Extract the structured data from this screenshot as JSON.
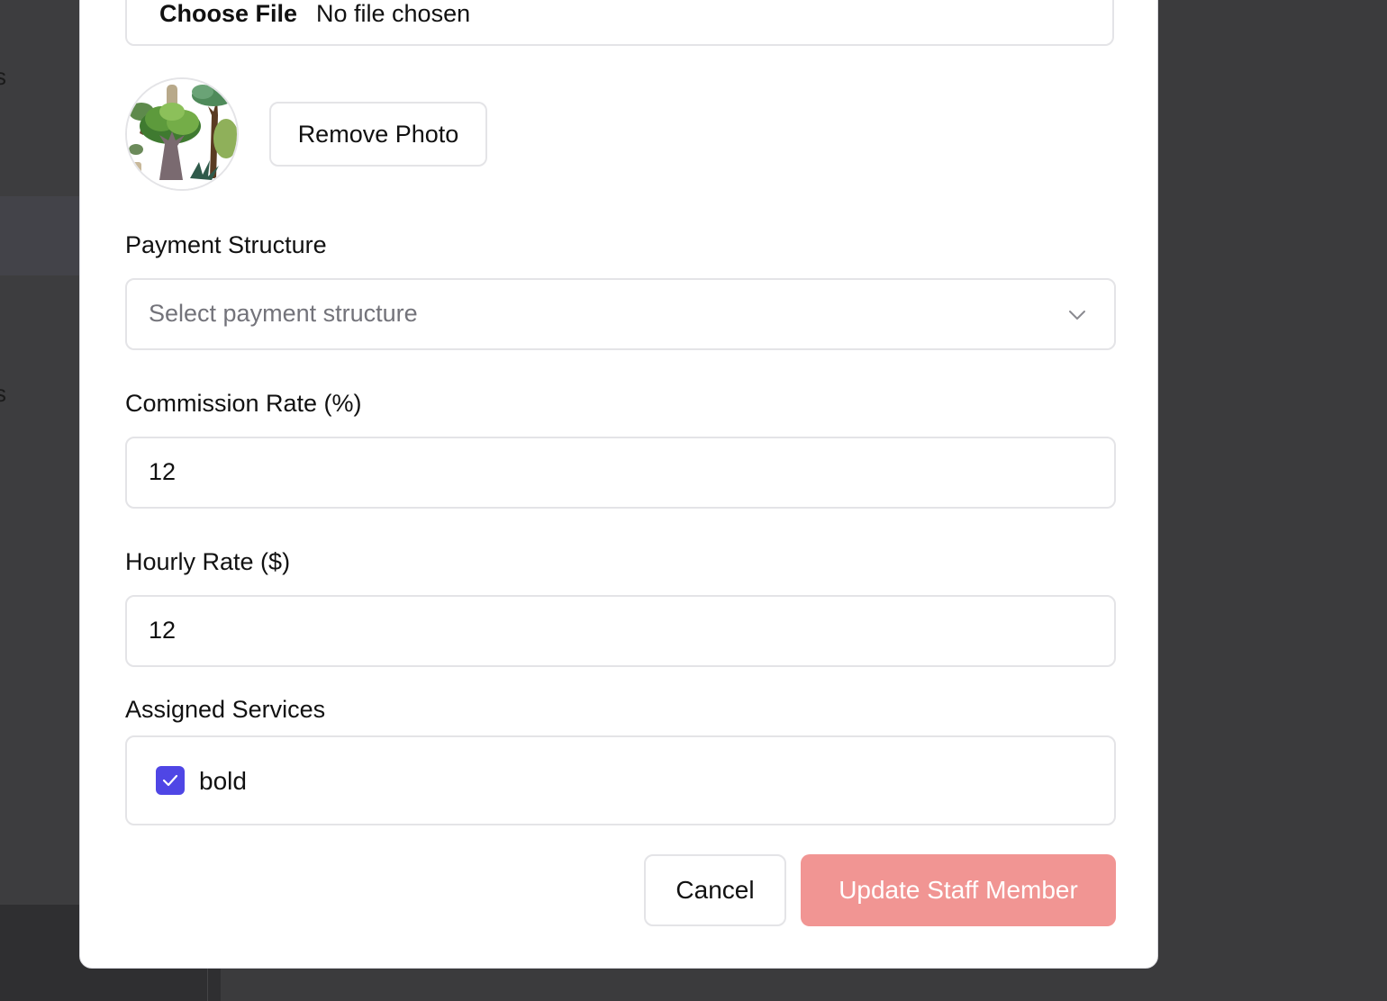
{
  "background": {
    "edge_text_top": "s",
    "edge_text_mid": "s"
  },
  "file_input": {
    "button_label": "Choose File",
    "status": "No file chosen"
  },
  "photo": {
    "remove_label": "Remove Photo"
  },
  "payment_structure": {
    "label": "Payment Structure",
    "placeholder": "Select payment structure"
  },
  "commission_rate": {
    "label": "Commission Rate (%)",
    "value": "12"
  },
  "hourly_rate": {
    "label": "Hourly Rate ($)",
    "value": "12"
  },
  "assigned_services": {
    "label": "Assigned Services",
    "items": [
      {
        "label": "bold",
        "checked": true
      }
    ]
  },
  "actions": {
    "cancel_label": "Cancel",
    "submit_label": "Update Staff Member"
  },
  "colors": {
    "accent_checkbox": "#4f46e5",
    "submit_disabled": "#f19593"
  }
}
